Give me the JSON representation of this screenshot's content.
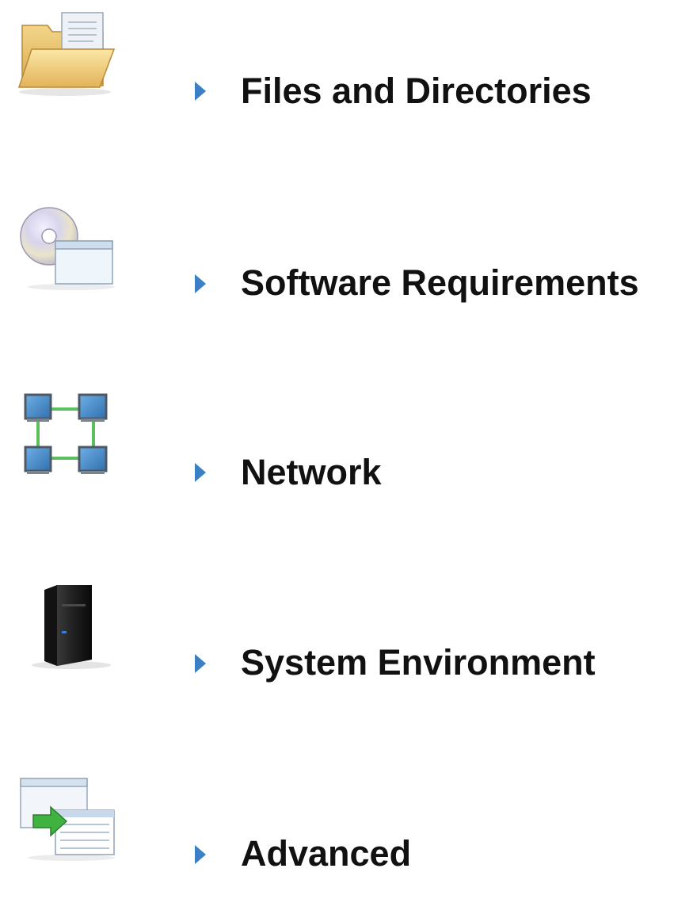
{
  "colors": {
    "chevron": "#3b7fc4",
    "label": "#111111"
  },
  "nav": {
    "items": [
      {
        "label": "Files and Directories",
        "icon": "folder-icon"
      },
      {
        "label": "Software Requirements",
        "icon": "cd-window-icon"
      },
      {
        "label": "Network",
        "icon": "network-icon"
      },
      {
        "label": "System Environment",
        "icon": "server-icon"
      },
      {
        "label": "Advanced",
        "icon": "window-transfer-icon"
      }
    ]
  }
}
